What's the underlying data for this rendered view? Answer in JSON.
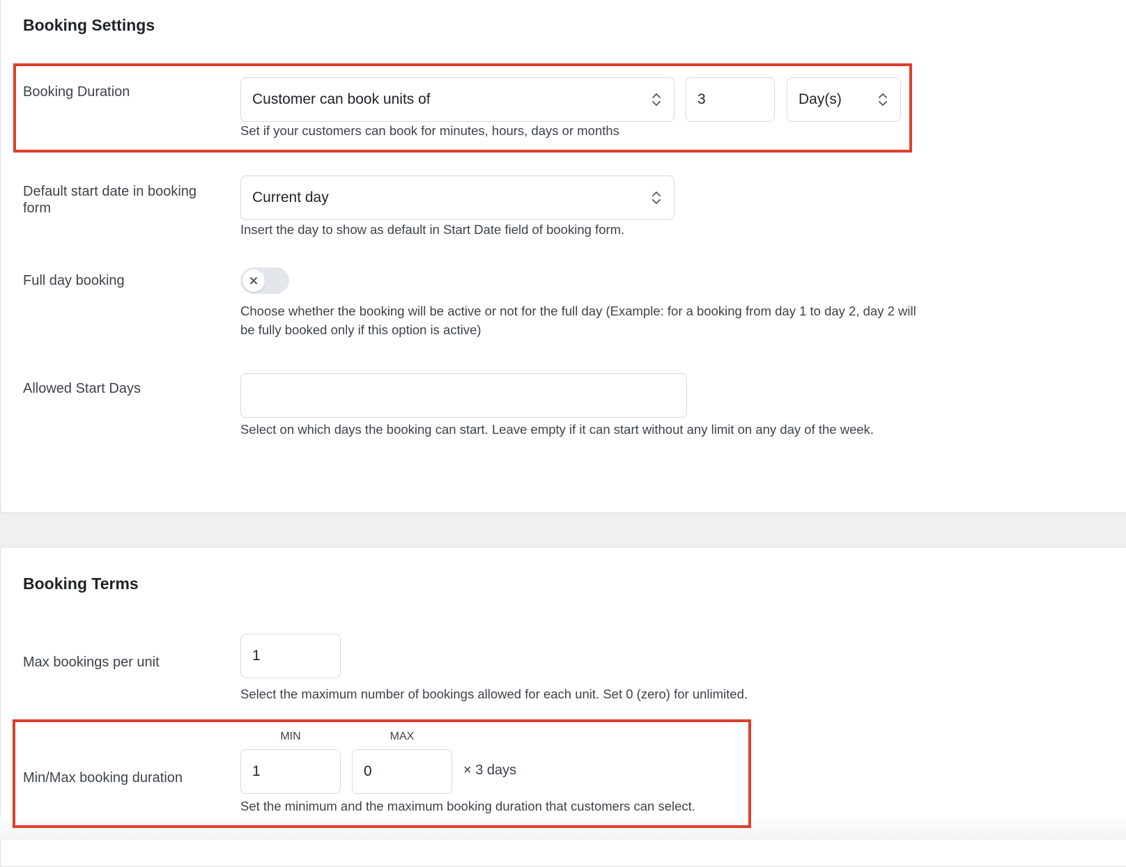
{
  "booking_settings": {
    "title": "Booking Settings",
    "duration": {
      "label": "Booking Duration",
      "mode_value": "Customer can book units of",
      "units_value": "3",
      "unit_type_value": "Day(s)",
      "help": "Set if your customers can book for minutes, hours, days or months"
    },
    "default_start": {
      "label": "Default start date in booking form",
      "value": "Current day",
      "help": "Insert the day to show as default in Start Date field of booking form."
    },
    "full_day": {
      "label": "Full day booking",
      "enabled": false,
      "help": "Choose whether the booking will be active or not for the full day (Example: for a booking from day 1 to day 2, day 2 will be fully booked only if this option is active)"
    },
    "allowed_start_days": {
      "label": "Allowed Start Days",
      "value": "",
      "help": "Select on which days the booking can start. Leave empty if it can start without any limit on any day of the week."
    }
  },
  "booking_terms": {
    "title": "Booking Terms",
    "max_bookings": {
      "label": "Max bookings per unit",
      "value": "1",
      "help": "Select the maximum number of bookings allowed for each unit. Set 0 (zero) for unlimited."
    },
    "min_max_duration": {
      "label": "Min/Max booking duration",
      "min_header": "MIN",
      "max_header": "MAX",
      "min_value": "1",
      "max_value": "0",
      "suffix": "× 3 days",
      "help": "Set the minimum and the maximum booking duration that customers can select."
    }
  },
  "colors": {
    "highlight": "#e03e2d",
    "background": "#f0f0f1",
    "panel": "#ffffff"
  }
}
